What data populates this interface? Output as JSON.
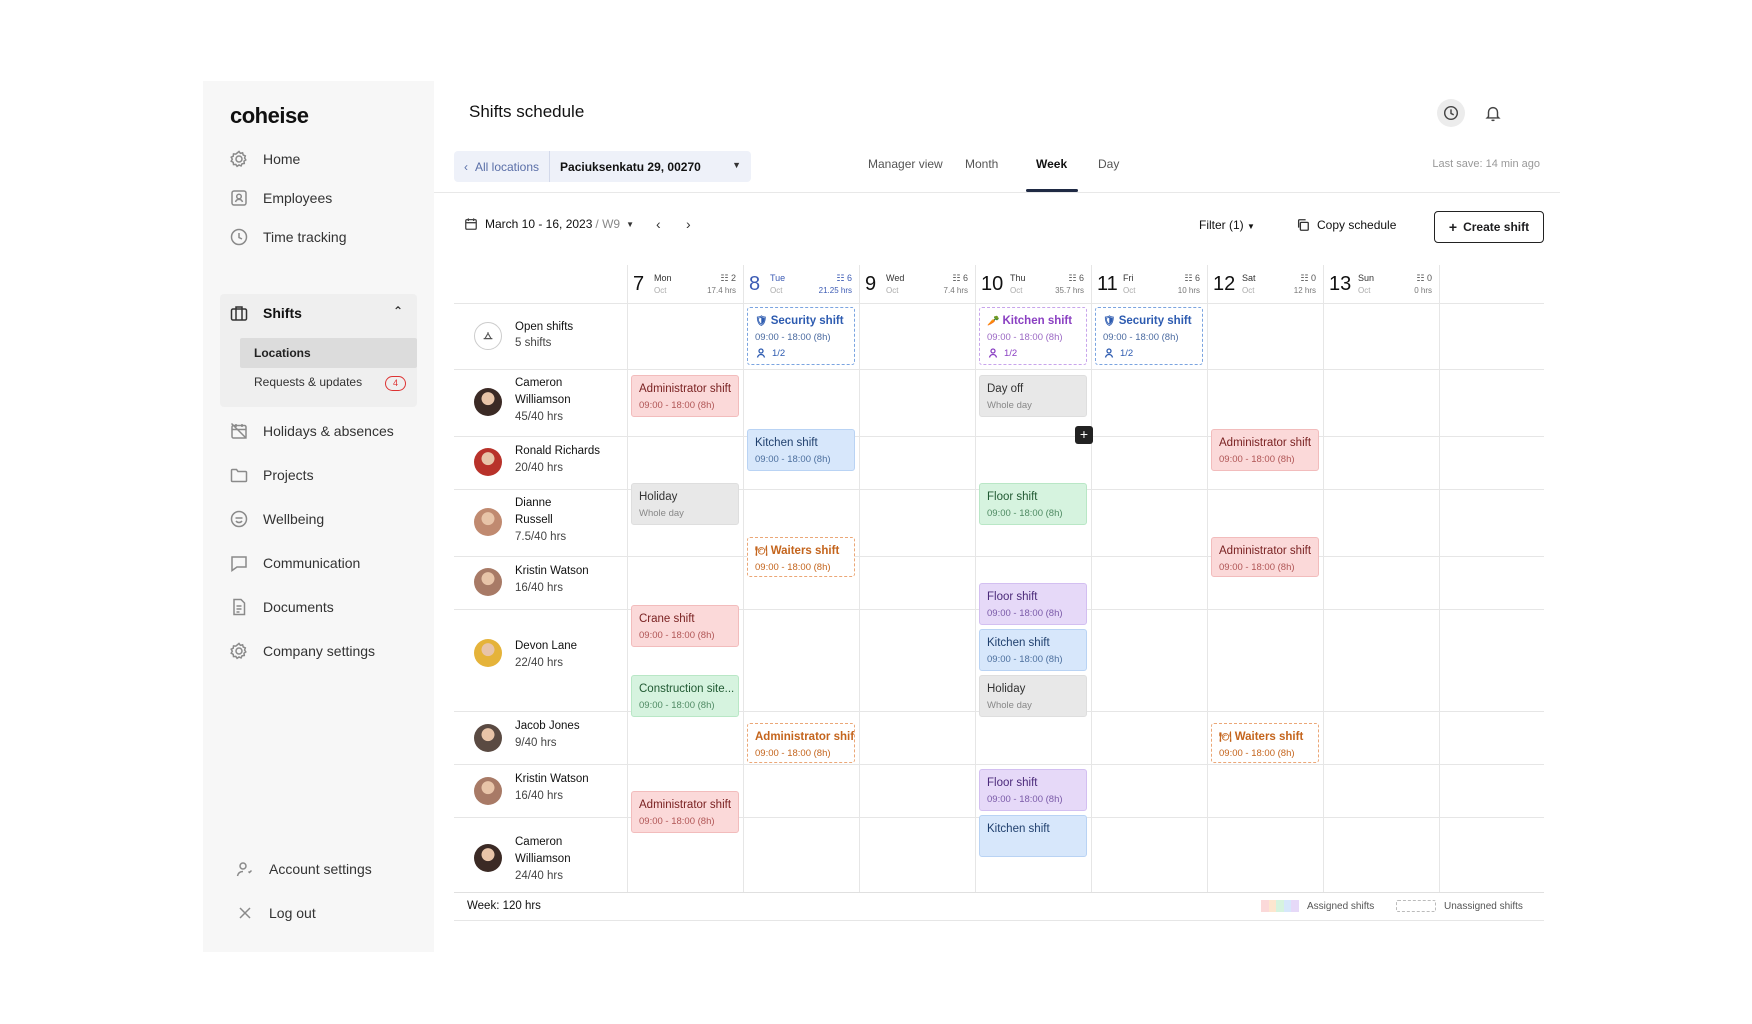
{
  "app": {
    "logo": "coheise"
  },
  "sidebar": {
    "items": [
      {
        "label": "Home",
        "icon": "gear-icon"
      },
      {
        "label": "Employees",
        "icon": "id-card-icon"
      },
      {
        "label": "Time tracking",
        "icon": "clock-icon"
      },
      {
        "label": "Shifts",
        "icon": "briefcase-icon"
      },
      {
        "label": "Holidays & absences",
        "icon": "calendar-off-icon"
      },
      {
        "label": "Projects",
        "icon": "folder-icon"
      },
      {
        "label": "Wellbeing",
        "icon": "smile-icon"
      },
      {
        "label": "Communication",
        "icon": "chat-icon"
      },
      {
        "label": "Documents",
        "icon": "document-icon"
      },
      {
        "label": "Company settings",
        "icon": "settings-icon"
      }
    ],
    "sub_items": [
      {
        "label": "Locations"
      },
      {
        "label": "Requests & updates",
        "badge": "4"
      }
    ],
    "bottom": [
      {
        "label": "Account settings",
        "icon": "user-settings-icon"
      },
      {
        "label": "Log out",
        "icon": "close-icon"
      }
    ]
  },
  "header": {
    "title": "Shifts schedule",
    "location_back": "All locations",
    "location_value": "Paciuksenkatu 29, 00270",
    "tabs": [
      "Manager view",
      "Month",
      "Week",
      "Day"
    ],
    "active_tab": "Week",
    "last_save": "Last save: 14 min ago"
  },
  "toolbar": {
    "date_range": "March 10 - 16, 2023",
    "week": "/ W9",
    "filter": "Filter (1)",
    "copy": "Copy schedule",
    "create": "Create shift"
  },
  "days": [
    {
      "num": "7",
      "name": "Mon",
      "month": "Oct",
      "count": "2",
      "hrs": "17.4 hrs",
      "today": false
    },
    {
      "num": "8",
      "name": "Tue",
      "month": "Oct",
      "count": "6",
      "hrs": "21.25 hrs",
      "today": true
    },
    {
      "num": "9",
      "name": "Wed",
      "month": "Oct",
      "count": "6",
      "hrs": "7.4 hrs",
      "today": false
    },
    {
      "num": "10",
      "name": "Thu",
      "month": "Oct",
      "count": "6",
      "hrs": "35.7 hrs",
      "today": false
    },
    {
      "num": "11",
      "name": "Fri",
      "month": "Oct",
      "count": "6",
      "hrs": "10 hrs",
      "today": false
    },
    {
      "num": "12",
      "name": "Sat",
      "month": "Oct",
      "count": "0",
      "hrs": "12 hrs",
      "today": false
    },
    {
      "num": "13",
      "name": "Sun",
      "month": "Oct",
      "count": "0",
      "hrs": "0 hrs",
      "today": false
    }
  ],
  "open_shifts": {
    "title": "Open shifts",
    "count": "5 shifts"
  },
  "employees": [
    {
      "name": "Cameron Williamson",
      "hours": "45/40 hrs",
      "avatar_color": "#3b2a25"
    },
    {
      "name": "Ronald Richards",
      "hours": "20/40 hrs",
      "avatar_color": "#b8322a"
    },
    {
      "name": "Dianne Russell",
      "hours": "7.5/40 hrs",
      "avatar_color": "#c08a70"
    },
    {
      "name": "Kristin Watson",
      "hours": "16/40 hrs",
      "avatar_color": "#a87a66"
    },
    {
      "name": "Devon Lane",
      "hours": "22/40 hrs",
      "avatar_color": "#e5b33a"
    },
    {
      "name": "Jacob Jones",
      "hours": "9/40 hrs",
      "avatar_color": "#5a4a42"
    },
    {
      "name": "Kristin Watson",
      "hours": "16/40 hrs",
      "avatar_color": "#a87a66"
    },
    {
      "name": "Cameron Williamson",
      "hours": "24/40 hrs",
      "avatar_color": "#3b2a25"
    }
  ],
  "shifts": [
    {
      "title": "Security shift",
      "time": "09:00 - 18:00 (8h)",
      "slots": "1/2",
      "style": "dash-blue",
      "icon": "🛡"
    },
    {
      "title": "Kitchen shift",
      "time": "09:00 - 18:00 (8h)",
      "slots": "1/2",
      "style": "dash-purple",
      "icon": "🥕"
    },
    {
      "title": "Security shift",
      "time": "09:00 - 18:00 (8h)",
      "slots": "1/2",
      "style": "dash-blue",
      "icon": "🛡"
    },
    {
      "title": "Administrator shift",
      "time": "09:00 - 18:00 (8h)",
      "style": "red"
    },
    {
      "title": "Day off",
      "time": "Whole day",
      "style": "gray"
    },
    {
      "title": "Kitchen shift",
      "time": "09:00 - 18:00 (8h)",
      "style": "blue"
    },
    {
      "title": "Administrator shift",
      "time": "09:00 - 18:00 (8h)",
      "style": "red"
    },
    {
      "title": "Holiday",
      "time": "Whole day",
      "style": "gray"
    },
    {
      "title": "Floor shift",
      "time": "09:00 - 18:00 (8h)",
      "style": "green"
    },
    {
      "title": "Waiters shift",
      "time": "09:00 - 18:00 (8h)",
      "style": "dash-orange",
      "icon": "🍽"
    },
    {
      "title": "Administrator shift",
      "time": "09:00 - 18:00 (8h)",
      "style": "red"
    },
    {
      "title": "Crane shift",
      "time": "09:00 - 18:00 (8h)",
      "style": "red"
    },
    {
      "title": "Floor shift",
      "time": "09:00 - 18:00 (8h)",
      "style": "purple"
    },
    {
      "title": "Kitchen shift",
      "time": "09:00 - 18:00 (8h)",
      "style": "blue"
    },
    {
      "title": "Construction site...",
      "time": "09:00 - 18:00 (8h)",
      "style": "green"
    },
    {
      "title": "Holiday",
      "time": "Whole day",
      "style": "gray"
    },
    {
      "title": "Administrator shift",
      "time": "09:00 - 18:00 (8h)",
      "style": "dash-orange"
    },
    {
      "title": "Waiters shift",
      "time": "09:00 - 18:00 (8h)",
      "style": "dash-orange",
      "icon": "🍽"
    },
    {
      "title": "Administrator shift",
      "time": "09:00 - 18:00 (8h)",
      "style": "red"
    },
    {
      "title": "Floor shift",
      "time": "09:00 - 18:00 (8h)",
      "style": "purple"
    },
    {
      "title": "Kitchen shift",
      "time": "",
      "style": "blue"
    }
  ],
  "footer": {
    "week_total": "Week: 120 hrs",
    "legend_assigned": "Assigned shifts",
    "legend_unassigned": "Unassigned shifts",
    "assigned_colors": [
      "#fbd9d9",
      "#fde6cf",
      "#d6f3df",
      "#d7e7fb",
      "#e6d9f8"
    ]
  }
}
